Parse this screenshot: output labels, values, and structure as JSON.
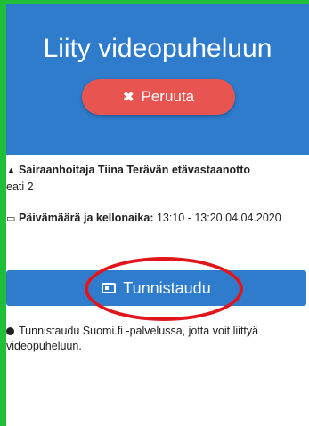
{
  "header": {
    "title": "Liity videopuheluun",
    "cancel_label": "Peruuta",
    "cancel_icon": "times-icon"
  },
  "appointment": {
    "provider": "Sairaanhoitaja Tiina Terävän etävastaanotto",
    "location": "eati 2",
    "datetime_label": "Päivämäärä ja kellonaika:",
    "datetime_value": "13:10 - 13:20 04.04.2020"
  },
  "auth": {
    "button_label": "Tunnistaudu",
    "note": "Tunnistaudu Suomi.fi -palvelussa, jotta voit liittyä videopuheluun."
  },
  "colors": {
    "header_blue": "#2f7bcc",
    "cancel_red": "#e85550",
    "annotation_red": "#e0161b",
    "border_green": "#1fbf3a"
  }
}
